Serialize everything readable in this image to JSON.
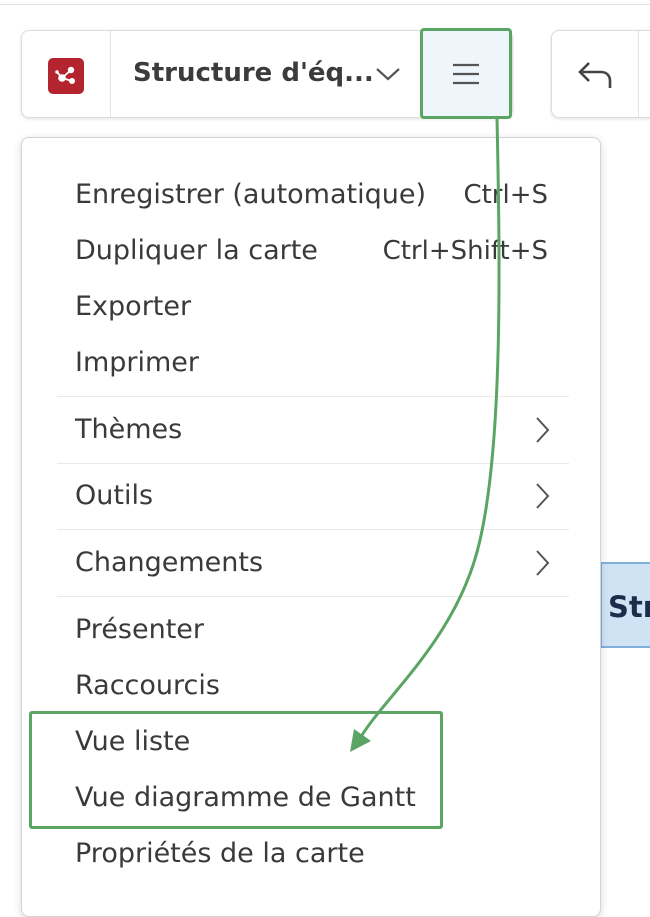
{
  "toolbar": {
    "document_title": "Structure d'éq...",
    "logo_icon": "mindmap-logo-icon",
    "menu_icon": "hamburger-menu-icon",
    "undo_icon": "undo-icon"
  },
  "background_node": {
    "text": "Str"
  },
  "menu": {
    "items": [
      {
        "label": "Enregistrer (automatique)",
        "shortcut": "Ctrl+S"
      },
      {
        "label": "Dupliquer la carte",
        "shortcut": "Ctrl+Shift+S"
      },
      {
        "label": "Exporter"
      },
      {
        "label": "Imprimer"
      },
      {
        "label": "Thèmes",
        "submenu": true
      },
      {
        "label": "Outils",
        "submenu": true
      },
      {
        "label": "Changements",
        "submenu": true
      },
      {
        "label": "Présenter"
      },
      {
        "label": "Raccourcis"
      },
      {
        "label": "Vue liste"
      },
      {
        "label": "Vue diagramme de Gantt"
      },
      {
        "label": "Propriétés de la carte"
      }
    ]
  },
  "colors": {
    "highlight": "#5aa564",
    "logo": "#b3242f",
    "menu_button_bg": "#eef5fb"
  }
}
